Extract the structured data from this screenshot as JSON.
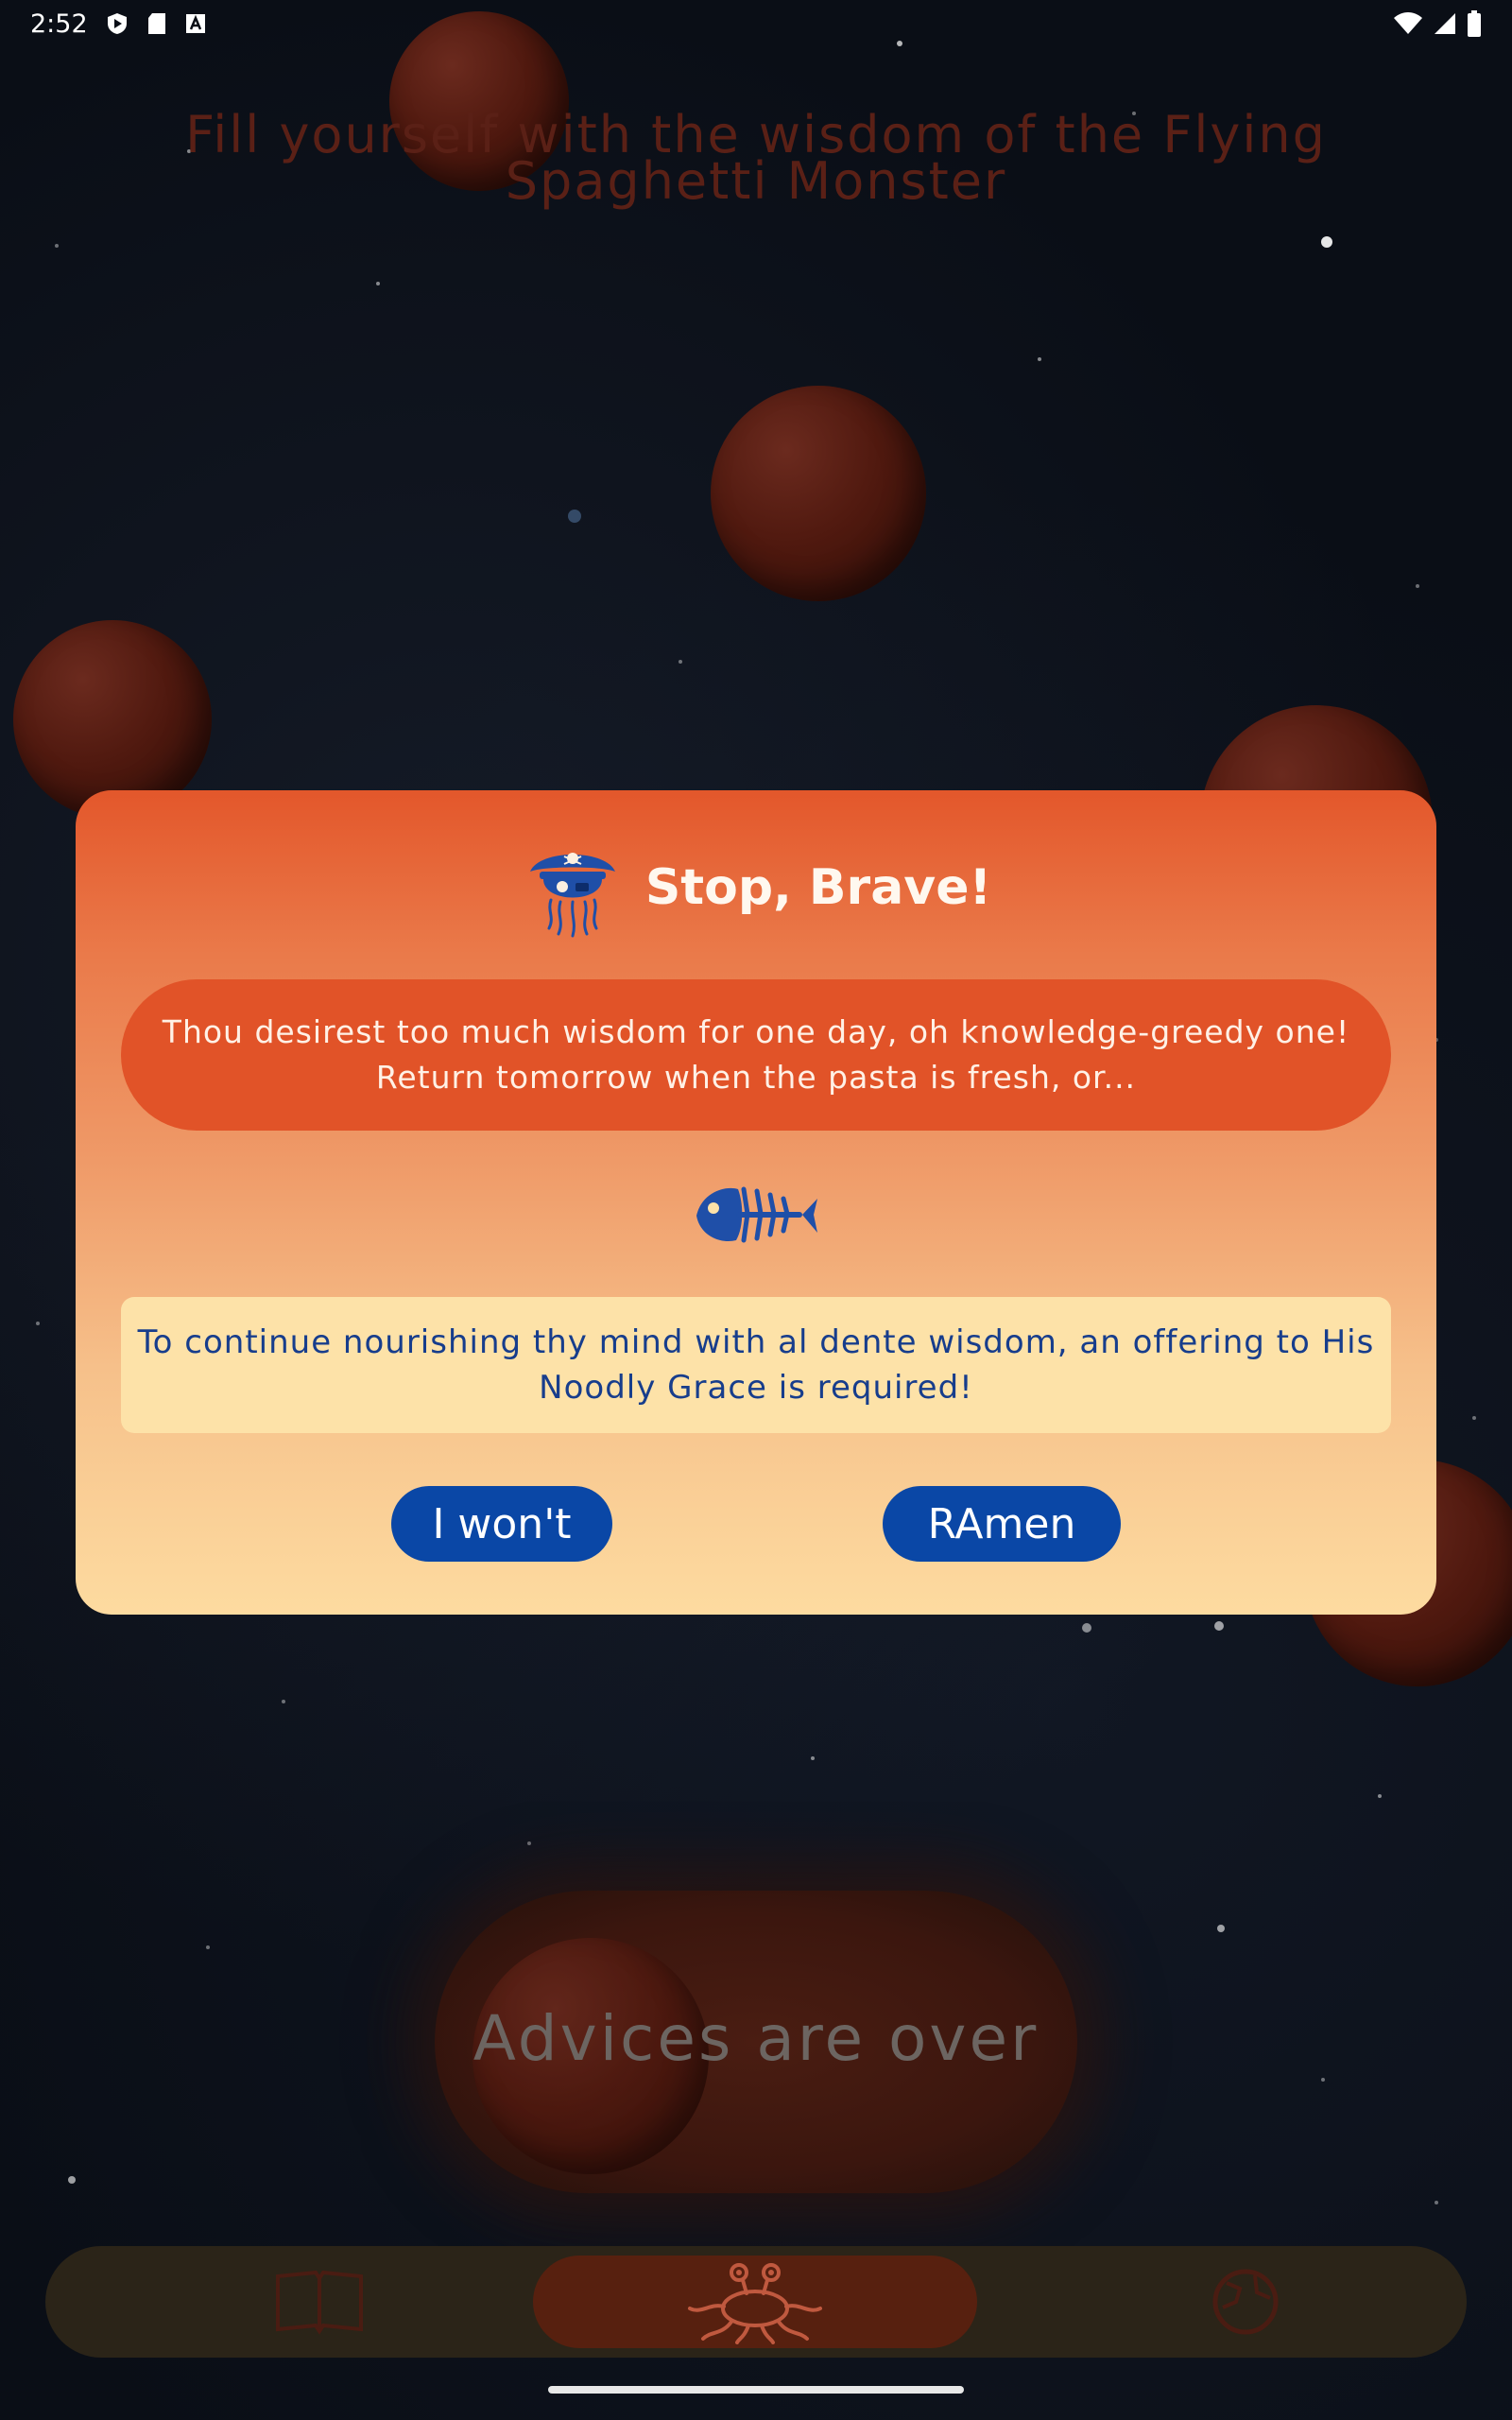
{
  "status_bar": {
    "time": "2:52"
  },
  "headline": "Fill yourself with the wisdom of the Flying Spaghetti Monster",
  "dialog": {
    "title": "Stop, Brave!",
    "title_icon": "pirate-jellyfish-icon",
    "warning_line1": "Thou desirest too much wisdom for one day, oh knowledge-greedy one!",
    "warning_line2": "Return tomorrow when the pasta is fresh, or...",
    "fish_icon": "fish-skeleton-icon",
    "offer_line1": "To continue nourishing thy mind with al dente wisdom, an offering to His",
    "offer_line2": "Noodly Grace is required!",
    "decline_label": "I won't",
    "accept_label": "RAmen"
  },
  "main_button": {
    "label": "Advices are over"
  },
  "bottom_nav": {
    "items": [
      "book-icon",
      "flying-spaghetti-monster-icon",
      "globe-icon"
    ]
  },
  "colors": {
    "dialog_top": "#e3572b",
    "dialog_bottom": "#fddba0",
    "button": "#0a47a6",
    "offer_text": "#173d8c"
  }
}
